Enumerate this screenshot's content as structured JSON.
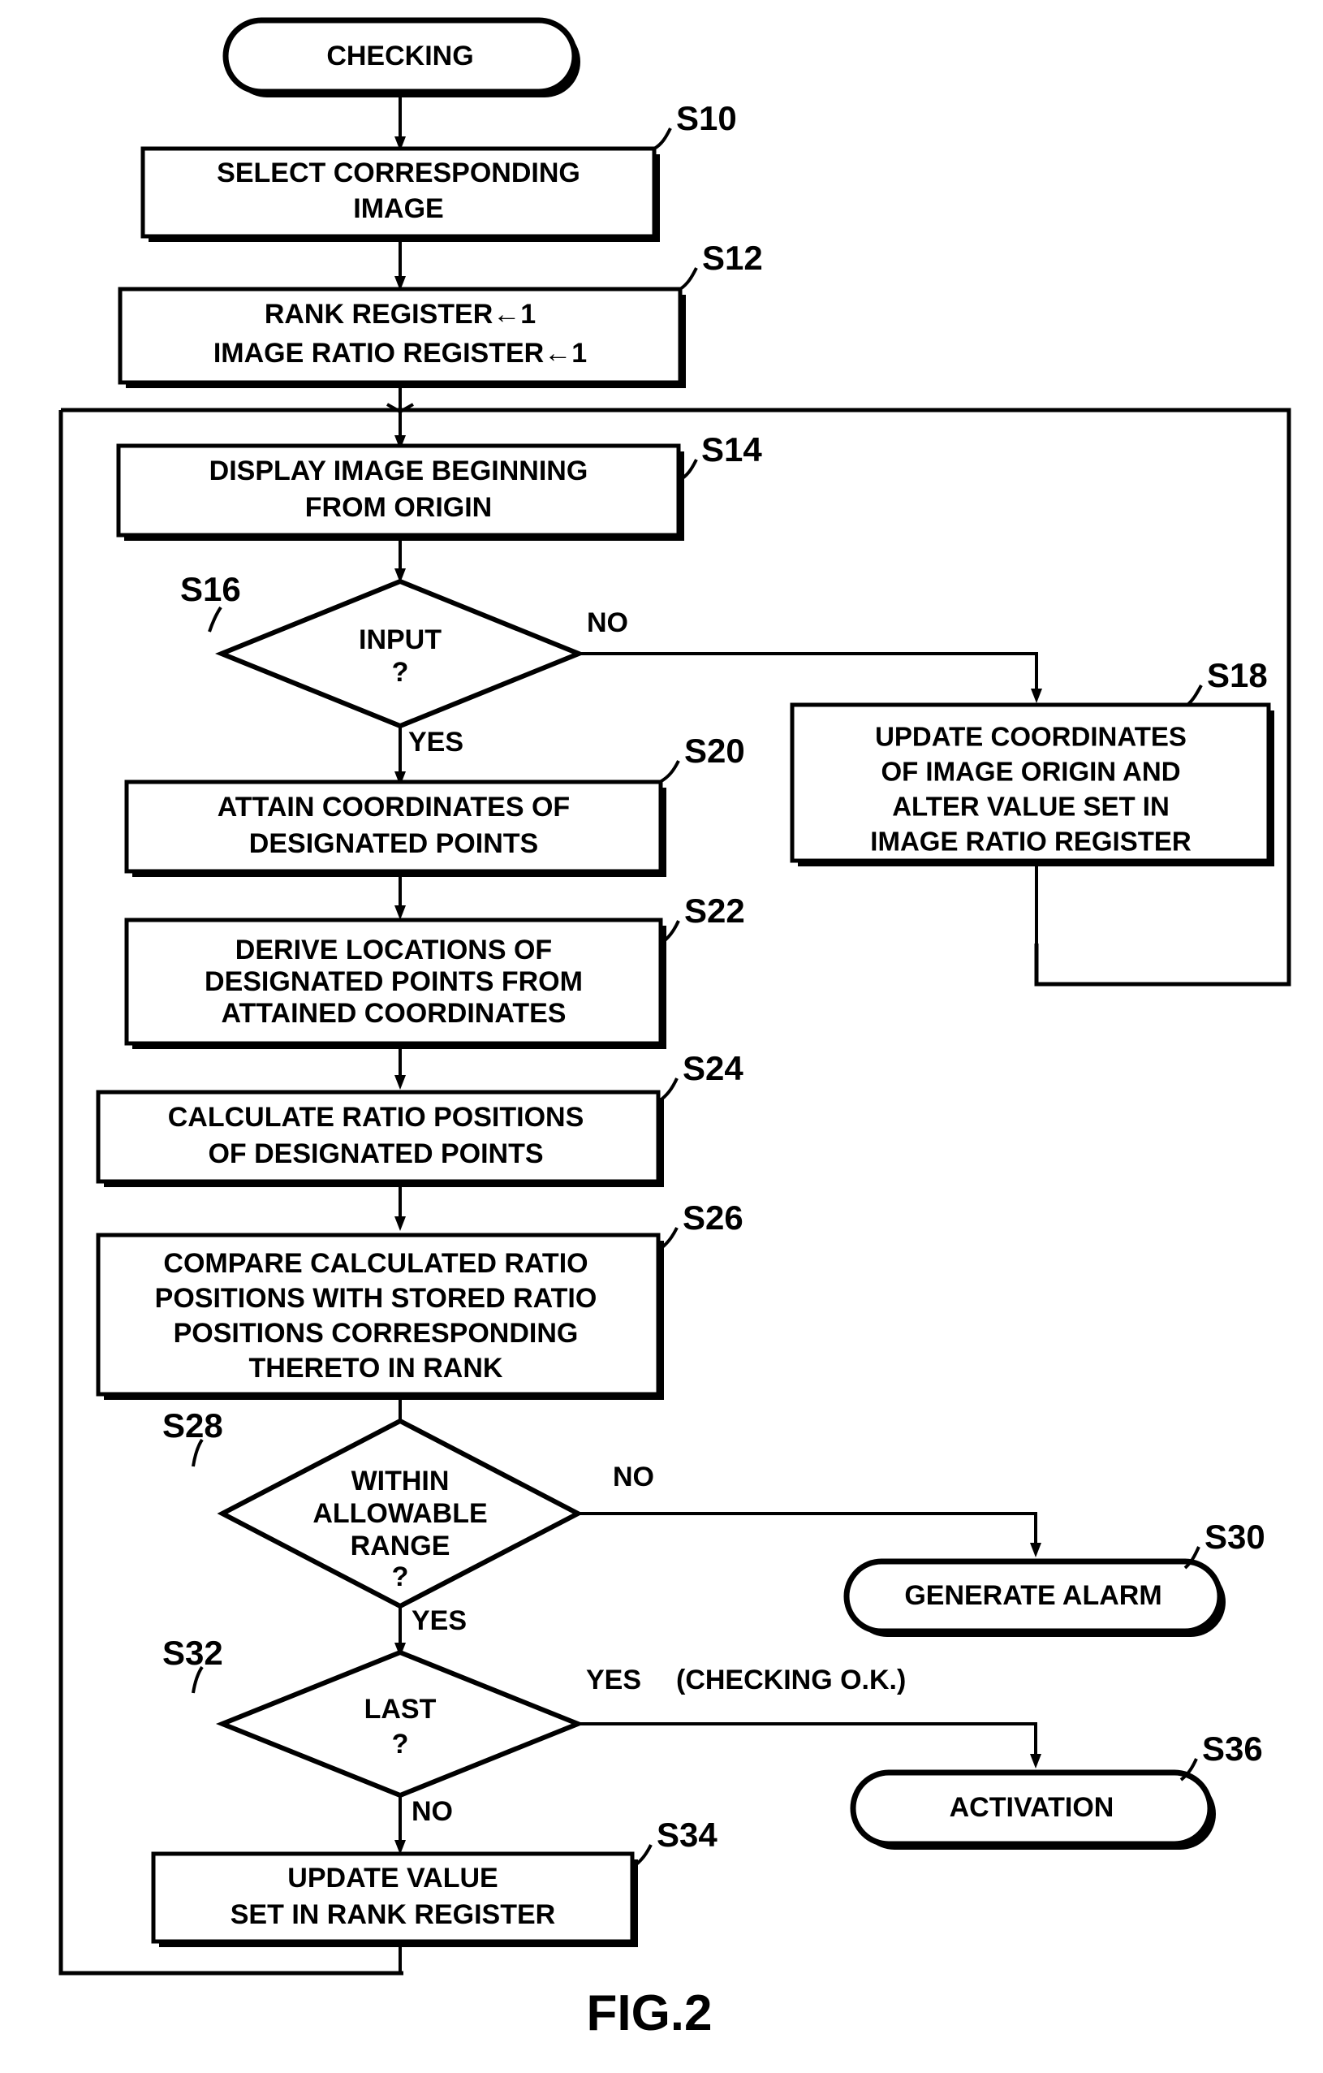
{
  "figure": {
    "caption": "FIG.2",
    "title": "CHECKING"
  },
  "nodes": {
    "start": {
      "id": "",
      "type": "terminator",
      "text": "CHECKING"
    },
    "s10": {
      "id": "S10",
      "type": "process",
      "lines": [
        "SELECT CORRESPONDING",
        "IMAGE"
      ]
    },
    "s12": {
      "id": "S12",
      "type": "process",
      "lines": [
        "RANK REGISTER←1",
        "IMAGE RATIO REGISTER←1"
      ]
    },
    "s14": {
      "id": "S14",
      "type": "process",
      "lines": [
        "DISPLAY IMAGE BEGINNING",
        "FROM ORIGIN"
      ]
    },
    "s16": {
      "id": "S16",
      "type": "decision",
      "lines": [
        "INPUT",
        "?"
      ]
    },
    "s18": {
      "id": "S18",
      "type": "process",
      "lines": [
        "UPDATE COORDINATES",
        "OF IMAGE ORIGIN AND",
        "ALTER VALUE SET IN",
        "IMAGE RATIO REGISTER"
      ]
    },
    "s20": {
      "id": "S20",
      "type": "process",
      "lines": [
        "ATTAIN COORDINATES OF",
        "DESIGNATED POINTS"
      ]
    },
    "s22": {
      "id": "S22",
      "type": "process",
      "lines": [
        "DERIVE LOCATIONS OF",
        "DESIGNATED POINTS FROM",
        "ATTAINED COORDINATES"
      ]
    },
    "s24": {
      "id": "S24",
      "type": "process",
      "lines": [
        "CALCULATE RATIO POSITIONS",
        "OF  DESIGNATED POINTS"
      ]
    },
    "s26": {
      "id": "S26",
      "type": "process",
      "lines": [
        "COMPARE CALCULATED RATIO",
        "POSITIONS WITH STORED RATIO",
        "POSITIONS CORRESPONDING",
        "THERETO IN RANK"
      ]
    },
    "s28": {
      "id": "S28",
      "type": "decision",
      "lines": [
        "WITHIN",
        "ALLOWABLE",
        "RANGE",
        "?"
      ]
    },
    "s30": {
      "id": "S30",
      "type": "terminator",
      "lines": [
        "GENERATE ALARM"
      ]
    },
    "s32": {
      "id": "S32",
      "type": "decision",
      "lines": [
        "LAST",
        "?"
      ]
    },
    "s34": {
      "id": "S34",
      "type": "process",
      "lines": [
        "UPDATE VALUE",
        "SET IN RANK REGISTER"
      ]
    },
    "s36": {
      "id": "S36",
      "type": "terminator",
      "lines": [
        "ACTIVATION"
      ]
    }
  },
  "edge_labels": {
    "s16_no": "NO",
    "s16_yes": "YES",
    "s28_no": "NO",
    "s28_yes": "YES",
    "s32_yes": "YES",
    "s32_yes_note": "(CHECKING O.K.)",
    "s32_no": "NO"
  },
  "colors": {
    "ink": "#000000",
    "paper": "#ffffff"
  }
}
